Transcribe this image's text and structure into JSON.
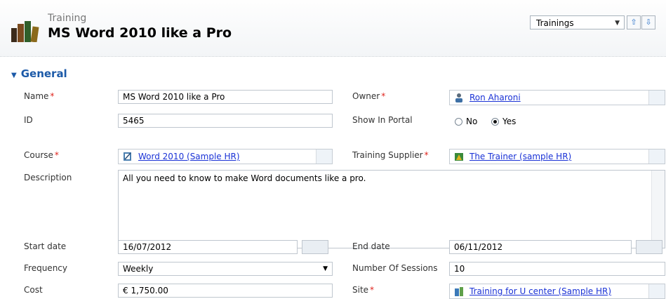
{
  "header": {
    "entity_label": "Training",
    "record_title": "MS Word 2010 like a Pro",
    "nav_select": "Trainings",
    "nav_up_icon": "arrow-up-icon",
    "nav_down_icon": "arrow-down-icon"
  },
  "section": {
    "title": "General"
  },
  "fields": {
    "name": {
      "label": "Name",
      "value": "MS Word 2010 like a Pro"
    },
    "id": {
      "label": "ID",
      "value": "5465"
    },
    "course": {
      "label": "Course",
      "value": "Word 2010 (Sample HR)"
    },
    "description": {
      "label": "Description",
      "value": "All you need to know to make Word documents like a pro."
    },
    "start_date": {
      "label": "Start date",
      "value": "16/07/2012"
    },
    "frequency": {
      "label": "Frequency",
      "value": "Weekly"
    },
    "cost": {
      "label": "Cost",
      "value": "€  1,750.00"
    },
    "owner": {
      "label": "Owner",
      "value": "Ron Aharoni"
    },
    "show_in_portal": {
      "label": "Show In Portal",
      "option_no": "No",
      "option_yes": "Yes",
      "selected": "Yes"
    },
    "training_supplier": {
      "label": "Training Supplier",
      "value": "The Trainer (sample HR)"
    },
    "end_date": {
      "label": "End date",
      "value": "06/11/2012"
    },
    "number_of_sessions": {
      "label": "Number Of Sessions",
      "value": "10"
    },
    "site": {
      "label": "Site",
      "value": "Training for U center (Sample HR)"
    }
  },
  "required_marker": "*",
  "colors": {
    "accent": "#1c5aa8",
    "link": "#1a32d6",
    "required": "#e0241d"
  }
}
